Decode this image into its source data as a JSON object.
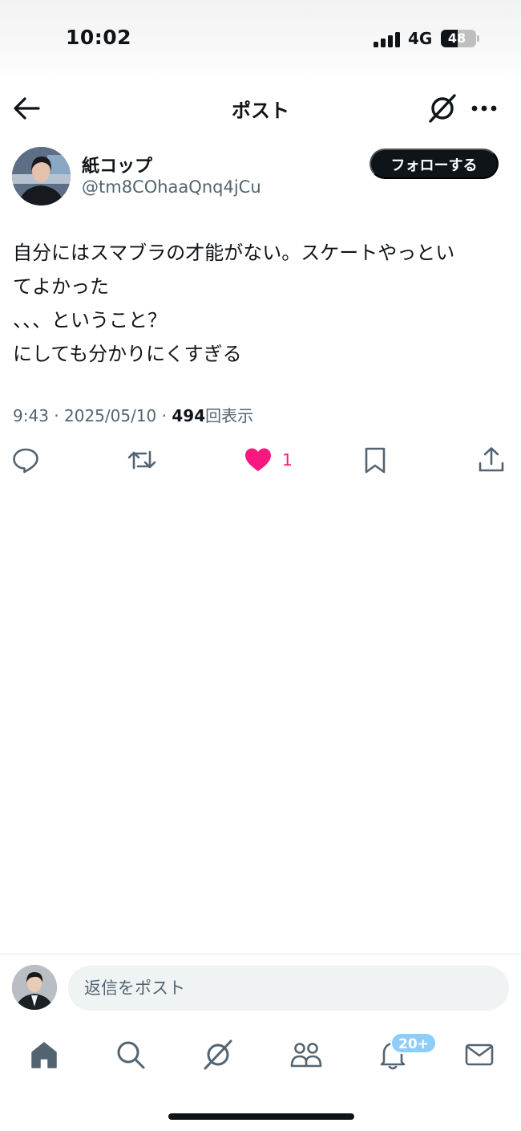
{
  "status_bar": {
    "time": "10:02",
    "network": "4G",
    "battery": "48",
    "battery_level": 0.48
  },
  "header": {
    "title": "ポスト",
    "icons": [
      "back-arrow-icon",
      "grok-icon",
      "more-icon"
    ]
  },
  "post": {
    "author": {
      "display_name": "紙コップ",
      "handle": "@tm8COhaaQnq4jCu"
    },
    "follow_label": "フォローする",
    "text_lines": [
      "自分にはスマブラの才能がない。スケートやっとい",
      "てよかった",
      "、、、ということ？",
      "にしても分かりにくすぎる"
    ],
    "time": "9:43",
    "date": "2025/05/10",
    "separator": "·",
    "views": "494",
    "views_label": "回表示",
    "like_count": "1",
    "action_icons": [
      "reply-icon",
      "retweet-icon",
      "like-icon",
      "bookmark-icon",
      "share-icon"
    ]
  },
  "reply": {
    "placeholder": "返信をポスト"
  },
  "tab_bar": {
    "icons": [
      "home-icon",
      "search-icon",
      "grok-icon",
      "communities-icon",
      "notifications-icon",
      "messages-icon"
    ],
    "notifications_badge": "20+"
  },
  "colors": {
    "text": "#0f1419",
    "secondary": "#536471",
    "like": "#f91880",
    "badge": "#8ecdf8",
    "follow_button": "#0f1419"
  }
}
